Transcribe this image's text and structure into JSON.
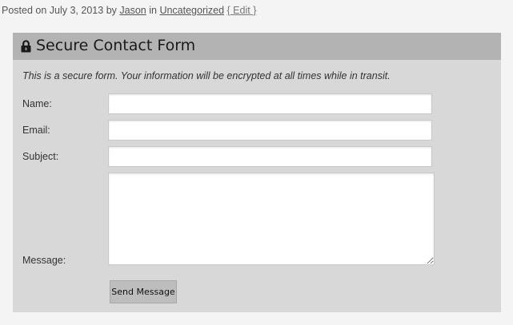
{
  "post_meta": {
    "posted_on_prefix": "Posted on",
    "date": "July 3, 2013",
    "by_text": "by",
    "author": "Jason",
    "in_text": "in",
    "category": "Uncategorized",
    "edit_link": "{ Edit }"
  },
  "form": {
    "title": "Secure Contact Form",
    "title_icon": "lock-icon",
    "intro": "This is a secure form. Your information will be encrypted at all times while in transit.",
    "fields": {
      "name": {
        "label": "Name:",
        "value": ""
      },
      "email": {
        "label": "Email:",
        "value": ""
      },
      "subject": {
        "label": "Subject:",
        "value": ""
      },
      "message": {
        "label": "Message:",
        "value": ""
      }
    },
    "submit_label": "Send Message"
  },
  "colors": {
    "page_background": "#f4f4f4",
    "form_background": "#d8d8d8",
    "header_background": "#b3b3b3",
    "button_background": "#bdbdbd"
  }
}
